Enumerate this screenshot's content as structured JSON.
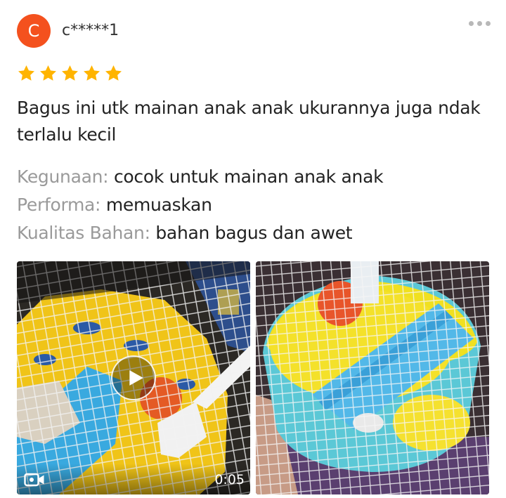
{
  "reviewer": {
    "avatar_letter": "C",
    "avatar_color": "#f4511e",
    "username": "c*****1"
  },
  "menu_icon": "more-horizontal-icon",
  "rating": {
    "stars": 5,
    "max": 5,
    "star_color": "#ffb400"
  },
  "review_text": "Bagus ini utk mainan anak anak ukurannya juga ndak terlalu kecil",
  "attributes": [
    {
      "label": "Kegunaan:",
      "value": "cocok untuk mainan anak anak"
    },
    {
      "label": "Performa:",
      "value": "memuaskan"
    },
    {
      "label": "Kualitas Bahan:",
      "value": "bahan bagus dan awet"
    }
  ],
  "media": {
    "video": {
      "duration": "0:05",
      "play_icon": "play-icon",
      "camera_icon": "video-camera-icon"
    },
    "photo": {
      "icon": "photo"
    }
  }
}
